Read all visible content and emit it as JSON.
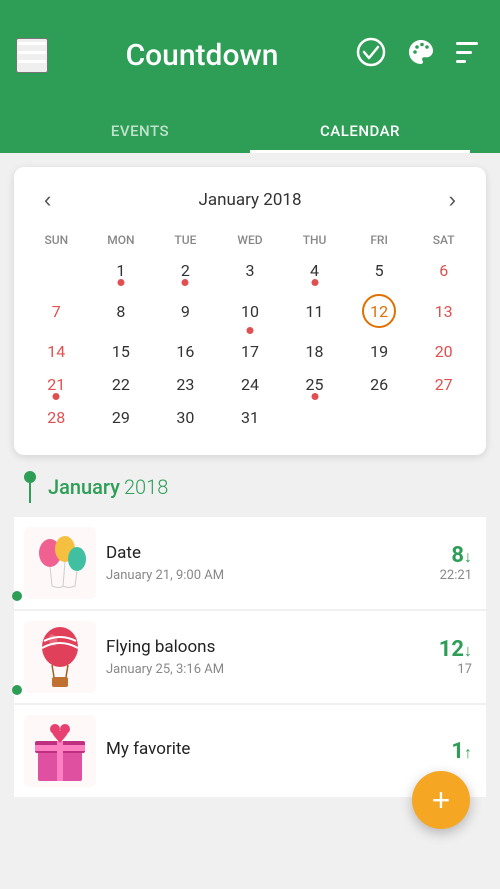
{
  "header": {
    "title": "Countdown",
    "menu_icon": "≡",
    "check_icon": "✔",
    "palette_icon": "🎨",
    "sort_icon": "≡"
  },
  "tabs": [
    {
      "id": "events",
      "label": "EVENTS",
      "active": false
    },
    {
      "id": "calendar",
      "label": "CALENDAR",
      "active": true
    }
  ],
  "calendar": {
    "month_title": "January 2018",
    "prev_icon": "‹",
    "next_icon": "›",
    "weekdays": [
      "SUN",
      "MON",
      "TUE",
      "WED",
      "THU",
      "FRI",
      "SAT"
    ],
    "today_day": 12,
    "weeks": [
      [
        null,
        1,
        2,
        3,
        4,
        5,
        6
      ],
      [
        7,
        8,
        9,
        10,
        11,
        12,
        13
      ],
      [
        14,
        15,
        16,
        17,
        18,
        19,
        20
      ],
      [
        21,
        22,
        23,
        24,
        25,
        26,
        27
      ],
      [
        28,
        29,
        30,
        31,
        null,
        null,
        null
      ]
    ],
    "dots": [
      1,
      2,
      4,
      10,
      21,
      25
    ]
  },
  "timeline": {
    "month": "January",
    "year": "2018"
  },
  "events": [
    {
      "name": "Date",
      "date": "January 21, 9:00 AM",
      "days": "8",
      "direction": "↓",
      "time": "22:21",
      "emoji": "🎈",
      "has_dot": false
    },
    {
      "name": "Flying baloons",
      "date": "January 25, 3:16 AM",
      "days": "12",
      "direction": "↓",
      "time": "17",
      "emoji": "🎈",
      "has_dot": true
    },
    {
      "name": "My favorite",
      "date": "",
      "days": "1",
      "direction": "↑",
      "time": "",
      "emoji": "❤",
      "has_dot": false
    }
  ],
  "fab": {
    "label": "+",
    "color": "#f5a623"
  }
}
